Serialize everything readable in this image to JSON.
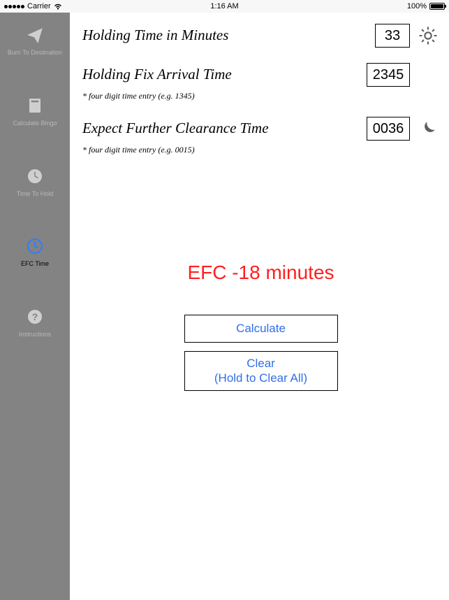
{
  "status": {
    "carrier": "Carrier",
    "time": "1:16 AM",
    "battery_pct": "100%"
  },
  "sidebar": {
    "items": [
      {
        "label": "Burn To Destination"
      },
      {
        "label": "Calculate Bingo"
      },
      {
        "label": "Time To Hold"
      },
      {
        "label": "EFC Time"
      },
      {
        "label": "Instructions"
      }
    ]
  },
  "fields": {
    "holding_time": {
      "label": "Holding Time in Minutes",
      "value": "33"
    },
    "arrival_time": {
      "label": "Holding Fix Arrival Time",
      "value": "2345",
      "hint": "* four digit time entry (e.g. 1345)"
    },
    "efc_time": {
      "label": "Expect Further Clearance Time",
      "value": "0036",
      "hint": "* four digit time entry (e.g. 0015)"
    }
  },
  "result": "EFC -18 minutes",
  "buttons": {
    "calculate": "Calculate",
    "clear": "Clear\n(Hold to Clear All)"
  }
}
